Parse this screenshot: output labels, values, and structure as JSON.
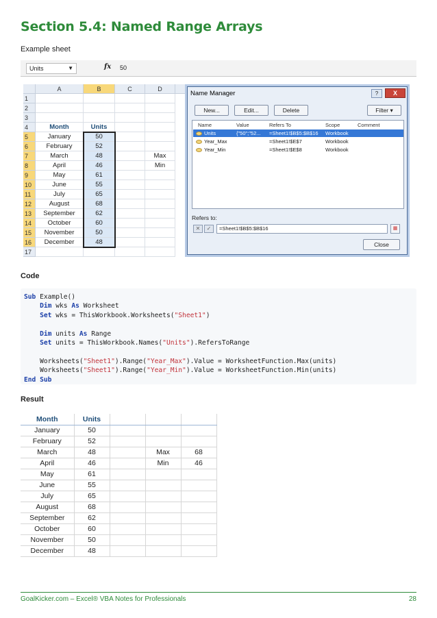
{
  "section_title": "Section 5.4: Named Range Arrays",
  "example_label": "Example sheet",
  "code_label": "Code",
  "result_label": "Result",
  "excel": {
    "name_box": "Units",
    "fx_label": "fx",
    "formula_value": "50",
    "columns": [
      "A",
      "B",
      "C",
      "D"
    ],
    "rows": [
      "1",
      "2",
      "3",
      "4",
      "5",
      "6",
      "7",
      "8",
      "9",
      "10",
      "11",
      "12",
      "13",
      "14",
      "15",
      "16",
      "17"
    ],
    "header_month": "Month",
    "header_units": "Units",
    "months": [
      "January",
      "February",
      "March",
      "April",
      "May",
      "June",
      "July",
      "August",
      "September",
      "October",
      "November",
      "December"
    ],
    "units": [
      "50",
      "52",
      "48",
      "46",
      "61",
      "55",
      "65",
      "68",
      "62",
      "60",
      "50",
      "48"
    ],
    "d_max": "Max",
    "d_min": "Min"
  },
  "name_manager": {
    "title": "Name Manager",
    "help_label": "?",
    "close_x": "X",
    "btn_new": "New...",
    "btn_edit": "Edit...",
    "btn_delete": "Delete",
    "btn_filter": "Filter ▾",
    "col_name": "Name",
    "col_value": "Value",
    "col_refers": "Refers To",
    "col_scope": "Scope",
    "col_comment": "Comment",
    "rows": [
      {
        "name": "Units",
        "value": "{\"50\";\"52...",
        "refers": "=Sheet1!$B$5:$B$16",
        "scope": "Workbook"
      },
      {
        "name": "Year_Max",
        "value": "",
        "refers": "=Sheet1!$E$7",
        "scope": "Workbook"
      },
      {
        "name": "Year_Min",
        "value": "",
        "refers": "=Sheet1!$E$8",
        "scope": "Workbook"
      }
    ],
    "refers_label": "Refers to:",
    "refers_value": "=Sheet1!$B$5:$B$16",
    "btn_close": "Close"
  },
  "result": {
    "header_month": "Month",
    "header_units": "Units",
    "max_label": "Max",
    "max_value": "68",
    "min_label": "Min",
    "min_value": "46"
  },
  "footer": {
    "text": "GoalKicker.com – Excel® VBA Notes for Professionals",
    "page": "28"
  }
}
